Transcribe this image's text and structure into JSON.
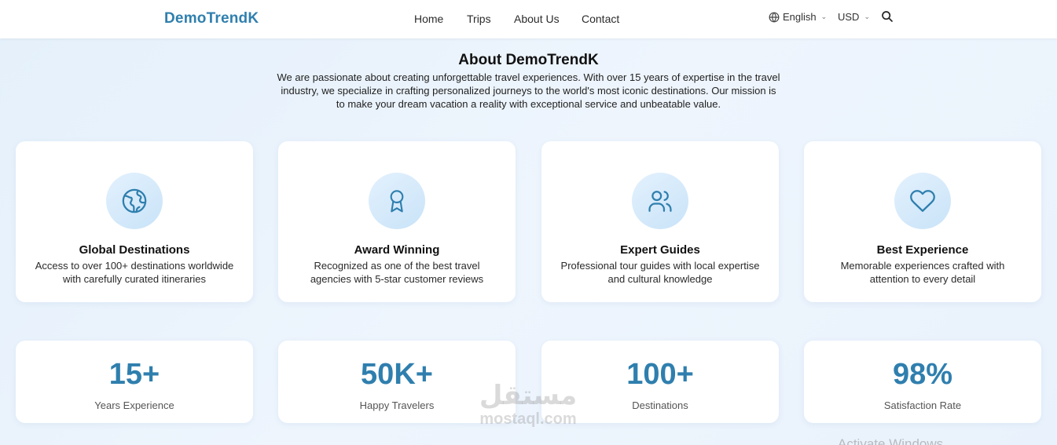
{
  "header": {
    "logo": "DemoTrendK",
    "nav": [
      "Home",
      "Trips",
      "About Us",
      "Contact"
    ],
    "language": "English",
    "currency": "USD"
  },
  "about": {
    "title": "About DemoTrendK",
    "text": "We are passionate about creating unforgettable travel experiences. With over 15 years of expertise in the travel industry, we specialize in crafting personalized journeys to the world's most iconic destinations. Our mission is to make your dream vacation a reality with exceptional service and unbeatable value."
  },
  "features": [
    {
      "icon": "globe-icon",
      "title": "Global Destinations",
      "desc": "Access to over 100+ destinations worldwide with carefully curated itineraries"
    },
    {
      "icon": "award-icon",
      "title": "Award Winning",
      "desc": "Recognized as one of the best travel agencies with 5-star customer reviews"
    },
    {
      "icon": "users-icon",
      "title": "Expert Guides",
      "desc": "Professional tour guides with local expertise and cultural knowledge"
    },
    {
      "icon": "heart-icon",
      "title": "Best Experience",
      "desc": "Memorable experiences crafted with attention to every detail"
    }
  ],
  "stats": [
    {
      "value": "15+",
      "label": "Years Experience"
    },
    {
      "value": "50K+",
      "label": "Happy Travelers"
    },
    {
      "value": "100+",
      "label": "Destinations"
    },
    {
      "value": "98%",
      "label": "Satisfaction Rate"
    }
  ],
  "watermark": {
    "arabic": "مستقل",
    "latin": "mostaql.com"
  },
  "overlay_text": "Activate Windows",
  "colors": {
    "accent": "#2f7fae",
    "background": "#e9f2fc",
    "icon_bg": "#d3e9fb"
  }
}
